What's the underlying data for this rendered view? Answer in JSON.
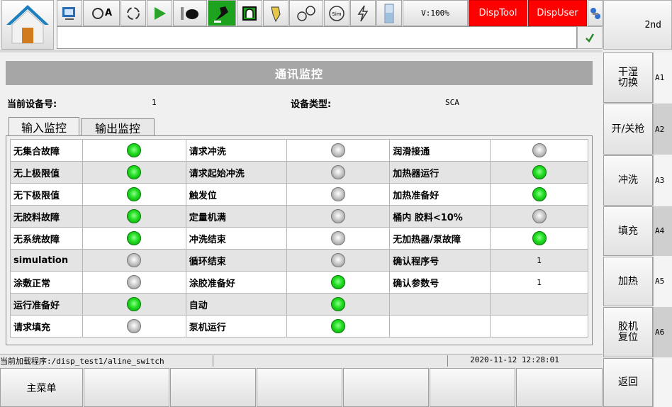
{
  "toolbar": {
    "icons": [
      "home-icon",
      "window-icon",
      "auto-icon",
      "cycle-icon",
      "play-icon",
      "hand-icon",
      "robot-icon",
      "door-icon",
      "valve-icon",
      "link-icon",
      "sim-icon",
      "bolt-icon",
      "glass-icon",
      "connect-icon"
    ],
    "sim_label": "Sim",
    "speed": "V:100%",
    "disp_tool": "DispTool",
    "disp_user": "DispUser",
    "second": "2nd"
  },
  "colors": {
    "accent_red": "#ff0000",
    "led_on": "#22dd22",
    "led_off": "#c8c8c8"
  },
  "page_title": "通讯监控",
  "device_no_label": "当前设备号:",
  "device_no": "1",
  "device_type_label": "设备类型:",
  "device_type": "SCA",
  "tabs": [
    "输入监控",
    "输出监控"
  ],
  "rows": [
    [
      {
        "l": "无集合故障",
        "s": "on"
      },
      {
        "l": "请求冲洗",
        "s": "off"
      },
      {
        "l": "润滑接通",
        "s": "off"
      }
    ],
    [
      {
        "l": "无上极限值",
        "s": "on"
      },
      {
        "l": "请求起始冲洗",
        "s": "off"
      },
      {
        "l": "加热器运行",
        "s": "on"
      }
    ],
    [
      {
        "l": "无下极限值",
        "s": "on"
      },
      {
        "l": "触发位",
        "s": "off"
      },
      {
        "l": "加热准备好",
        "s": "on"
      }
    ],
    [
      {
        "l": "无胶料故障",
        "s": "on"
      },
      {
        "l": "定量机满",
        "s": "off"
      },
      {
        "l": "桶内 胶料<10%",
        "s": "off"
      }
    ],
    [
      {
        "l": "无系统故障",
        "s": "on"
      },
      {
        "l": "冲洗结束",
        "s": "off"
      },
      {
        "l": "无加热器/泵故障",
        "s": "on"
      }
    ],
    [
      {
        "l": "simulation",
        "s": "off"
      },
      {
        "l": "循环结束",
        "s": "off"
      },
      {
        "l": "确认程序号",
        "v": "1"
      }
    ],
    [
      {
        "l": "涂敷正常",
        "s": "off"
      },
      {
        "l": "涂胶准备好",
        "s": "on"
      },
      {
        "l": "确认参数号",
        "v": "1"
      }
    ],
    [
      {
        "l": "运行准备好",
        "s": "on"
      },
      {
        "l": "自动",
        "s": "on"
      },
      {
        "l": "",
        "v": ""
      }
    ],
    [
      {
        "l": "请求填充",
        "s": "off"
      },
      {
        "l": "泵机运行",
        "s": "on"
      },
      {
        "l": "",
        "v": ""
      }
    ]
  ],
  "status": {
    "program": "当前加载程序:/disp_test1/aline_switch",
    "datetime": "2020-11-12 12:28:01"
  },
  "bottom": {
    "main_menu": "主菜单"
  },
  "side_buttons": [
    {
      "label": "干湿\n切换",
      "tag": "A1"
    },
    {
      "label": "开/关枪",
      "tag": "A2"
    },
    {
      "label": "冲洗",
      "tag": "A3"
    },
    {
      "label": "填充",
      "tag": "A4"
    },
    {
      "label": "加热",
      "tag": "A5"
    },
    {
      "label": "胶机\n复位",
      "tag": "A6"
    },
    {
      "label": "返回",
      "tag": ""
    }
  ]
}
